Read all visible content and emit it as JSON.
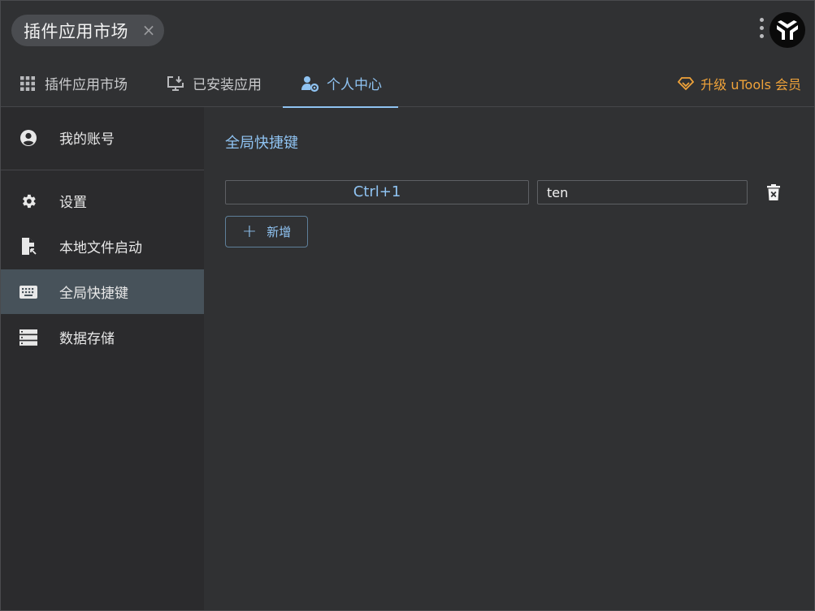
{
  "app_chip": {
    "label": "插件应用市场",
    "close_icon": "close-icon"
  },
  "tabs": [
    {
      "label": "插件应用市场",
      "icon": "grid-icon",
      "active": false
    },
    {
      "label": "已安装应用",
      "icon": "installed-monitor-icon",
      "active": false
    },
    {
      "label": "个人中心",
      "icon": "user-gear-icon",
      "active": true
    }
  ],
  "upgrade": {
    "label": "升级 uTools 会员",
    "icon": "diamond-icon",
    "color": "#f0a33a"
  },
  "sidebar": {
    "items": [
      {
        "label": "我的账号",
        "icon": "account-circle-icon",
        "active": false
      },
      {
        "label": "设置",
        "icon": "gear-icon",
        "active": false
      },
      {
        "label": "本地文件启动",
        "icon": "file-launch-icon",
        "active": false
      },
      {
        "label": "全局快捷键",
        "icon": "keyboard-icon",
        "active": true
      },
      {
        "label": "数据存储",
        "icon": "storage-icon",
        "active": false
      }
    ]
  },
  "main": {
    "title": "全局快捷键",
    "hotkeys": [
      {
        "shortcut": "Ctrl+1",
        "keyword": "ten"
      }
    ],
    "add_label": "新增"
  },
  "colors": {
    "accent": "#8fc3f2",
    "background": "#303133",
    "sidebar": "#2b2b2d",
    "sidebar_active": "#47525a"
  }
}
